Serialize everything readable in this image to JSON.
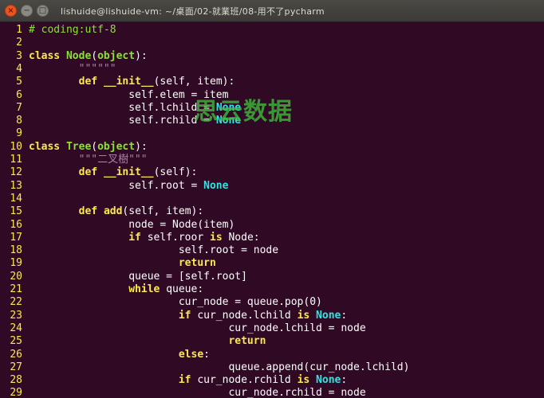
{
  "window": {
    "title": "lishuide@lishuide-vm: ~/桌面/02-就業班/08-用不了pycharm",
    "buttons": {
      "close": "×",
      "minimize": "−",
      "maximize": "□"
    }
  },
  "watermark": "思云数据",
  "colors": {
    "background": "#300a24",
    "line_number": "#fce94f",
    "keyword": "#fce94f",
    "class_name": "#8ae234",
    "none_constant": "#34e2e2",
    "comment": "#8ae234",
    "string": "#ad7fa8",
    "close_button": "#e95420"
  },
  "code_lines": [
    {
      "n": "1",
      "segments": [
        {
          "t": "# coding:utf-8",
          "c": "cmt"
        }
      ]
    },
    {
      "n": "2",
      "segments": []
    },
    {
      "n": "3",
      "segments": [
        {
          "t": "class ",
          "c": "kw"
        },
        {
          "t": "Node",
          "c": "cls"
        },
        {
          "t": "("
        },
        {
          "t": "object",
          "c": "cls"
        },
        {
          "t": "):"
        }
      ]
    },
    {
      "n": "4",
      "segments": [
        {
          "t": "        \"\"\"\"\"\"",
          "c": "str"
        }
      ]
    },
    {
      "n": "5",
      "segments": [
        {
          "t": "        "
        },
        {
          "t": "def ",
          "c": "kw"
        },
        {
          "t": "__init__",
          "c": "kw"
        },
        {
          "t": "(self, item):"
        }
      ]
    },
    {
      "n": "6",
      "segments": [
        {
          "t": "                self.elem = item"
        }
      ]
    },
    {
      "n": "7",
      "segments": [
        {
          "t": "                self.lchild = "
        },
        {
          "t": "None",
          "c": "none"
        }
      ]
    },
    {
      "n": "8",
      "segments": [
        {
          "t": "                self.rchild = "
        },
        {
          "t": "None",
          "c": "none"
        }
      ]
    },
    {
      "n": "9",
      "segments": []
    },
    {
      "n": "10",
      "segments": [
        {
          "t": "class ",
          "c": "kw"
        },
        {
          "t": "Tree",
          "c": "cls"
        },
        {
          "t": "("
        },
        {
          "t": "object",
          "c": "cls"
        },
        {
          "t": "):"
        }
      ]
    },
    {
      "n": "11",
      "segments": [
        {
          "t": "        \"\"\"二叉樹\"\"\"",
          "c": "str"
        }
      ]
    },
    {
      "n": "12",
      "segments": [
        {
          "t": "        "
        },
        {
          "t": "def ",
          "c": "kw"
        },
        {
          "t": "__init__",
          "c": "kw"
        },
        {
          "t": "(self):"
        }
      ]
    },
    {
      "n": "13",
      "segments": [
        {
          "t": "                self.root = "
        },
        {
          "t": "None",
          "c": "none"
        }
      ]
    },
    {
      "n": "14",
      "segments": []
    },
    {
      "n": "15",
      "segments": [
        {
          "t": "        "
        },
        {
          "t": "def ",
          "c": "kw"
        },
        {
          "t": "add",
          "c": "kw"
        },
        {
          "t": "(self, item):"
        }
      ]
    },
    {
      "n": "16",
      "segments": [
        {
          "t": "                node = Node(item)"
        }
      ]
    },
    {
      "n": "17",
      "segments": [
        {
          "t": "                "
        },
        {
          "t": "if ",
          "c": "kw"
        },
        {
          "t": "self.roor "
        },
        {
          "t": "is ",
          "c": "kw"
        },
        {
          "t": "Node:"
        }
      ]
    },
    {
      "n": "18",
      "segments": [
        {
          "t": "                        self.root = node"
        }
      ]
    },
    {
      "n": "19",
      "segments": [
        {
          "t": "                        "
        },
        {
          "t": "return",
          "c": "kw"
        }
      ]
    },
    {
      "n": "20",
      "segments": [
        {
          "t": "                queue = [self.root]"
        }
      ]
    },
    {
      "n": "21",
      "segments": [
        {
          "t": "                "
        },
        {
          "t": "while ",
          "c": "kw"
        },
        {
          "t": "queue:"
        }
      ]
    },
    {
      "n": "22",
      "segments": [
        {
          "t": "                        cur_node = queue.pop(0)"
        }
      ]
    },
    {
      "n": "23",
      "segments": [
        {
          "t": "                        "
        },
        {
          "t": "if ",
          "c": "kw"
        },
        {
          "t": "cur_node.lchild "
        },
        {
          "t": "is ",
          "c": "kw"
        },
        {
          "t": "None",
          "c": "none"
        },
        {
          "t": ":"
        }
      ]
    },
    {
      "n": "24",
      "segments": [
        {
          "t": "                                cur_node.lchild = node"
        }
      ]
    },
    {
      "n": "25",
      "segments": [
        {
          "t": "                                "
        },
        {
          "t": "return",
          "c": "kw"
        }
      ]
    },
    {
      "n": "26",
      "segments": [
        {
          "t": "                        "
        },
        {
          "t": "else",
          "c": "kw"
        },
        {
          "t": ":"
        }
      ]
    },
    {
      "n": "27",
      "segments": [
        {
          "t": "                                queue.append(cur_node.lchild)"
        }
      ]
    },
    {
      "n": "28",
      "segments": [
        {
          "t": "                        "
        },
        {
          "t": "if ",
          "c": "kw"
        },
        {
          "t": "cur_node.rchild "
        },
        {
          "t": "is ",
          "c": "kw"
        },
        {
          "t": "None",
          "c": "none"
        },
        {
          "t": ":"
        }
      ]
    },
    {
      "n": "29",
      "segments": [
        {
          "t": "                                cur_node.rchild = node"
        }
      ]
    }
  ]
}
